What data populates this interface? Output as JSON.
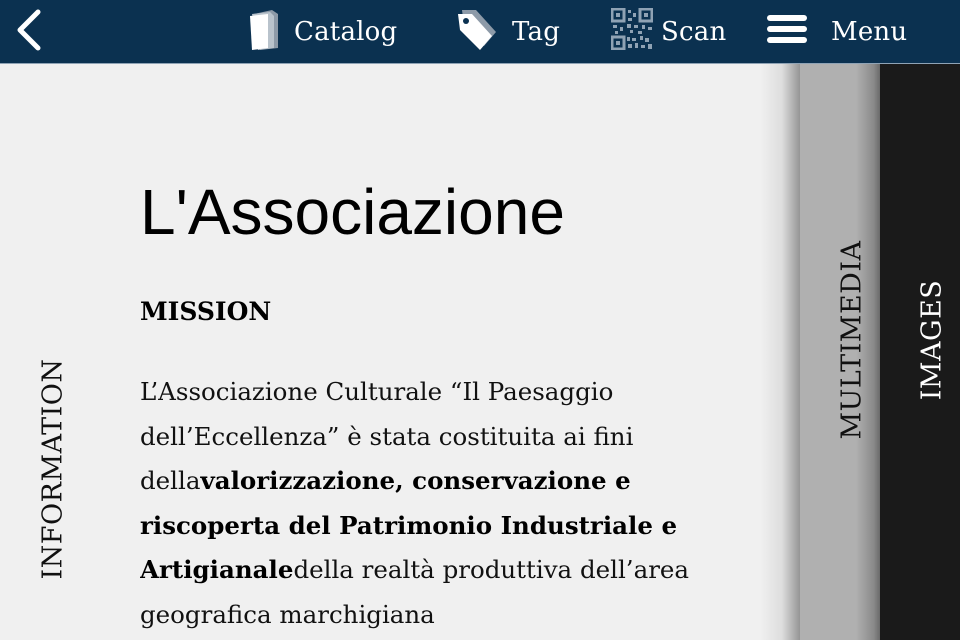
{
  "header": {
    "back_icon": "chevron-left-icon",
    "nav": [
      {
        "label": "Catalog",
        "icon": "book-icon"
      },
      {
        "label": "Tag",
        "icon": "tag-icon"
      },
      {
        "label": "Scan",
        "icon": "qr-code-icon"
      },
      {
        "label": "Menu",
        "icon": "hamburger-menu-icon"
      }
    ],
    "colors": {
      "background": "#0b3150",
      "text": "#ffffff"
    }
  },
  "tabs": {
    "information": "INFORMATION",
    "multimedia": "MULTIMEDIA",
    "images": "IMAGES"
  },
  "content": {
    "title": "L'Associazione",
    "section_title": "MISSION",
    "paragraph": {
      "part1": "L’Associazione Culturale “Il Paesaggio dell’Eccellenza” è stata costituita ai fini della",
      "bold1": "valorizzazione, conservazione e riscoperta del Patrimonio Industriale e Artigianale",
      "part2": "della realtà produttiva dell’area geografica marchigiana"
    }
  }
}
